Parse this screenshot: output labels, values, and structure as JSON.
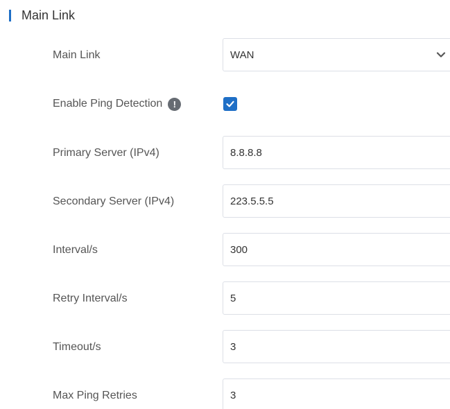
{
  "section": {
    "title": "Main Link"
  },
  "fields": {
    "main_link": {
      "label": "Main Link",
      "value": "WAN"
    },
    "ping_detection": {
      "label": "Enable Ping Detection",
      "checked": true
    },
    "primary_server": {
      "label": "Primary Server (IPv4)",
      "value": "8.8.8.8"
    },
    "secondary_server": {
      "label": "Secondary Server (IPv4)",
      "value": "223.5.5.5"
    },
    "interval": {
      "label": "Interval/s",
      "value": "300"
    },
    "retry_interval": {
      "label": "Retry Interval/s",
      "value": "5"
    },
    "timeout": {
      "label": "Timeout/s",
      "value": "3"
    },
    "max_ping_retries": {
      "label": "Max Ping Retries",
      "value": "3"
    }
  },
  "icons": {
    "info": "!"
  },
  "colors": {
    "accent": "#1f6fc6",
    "label": "#555555",
    "border": "#dcdfe6"
  }
}
